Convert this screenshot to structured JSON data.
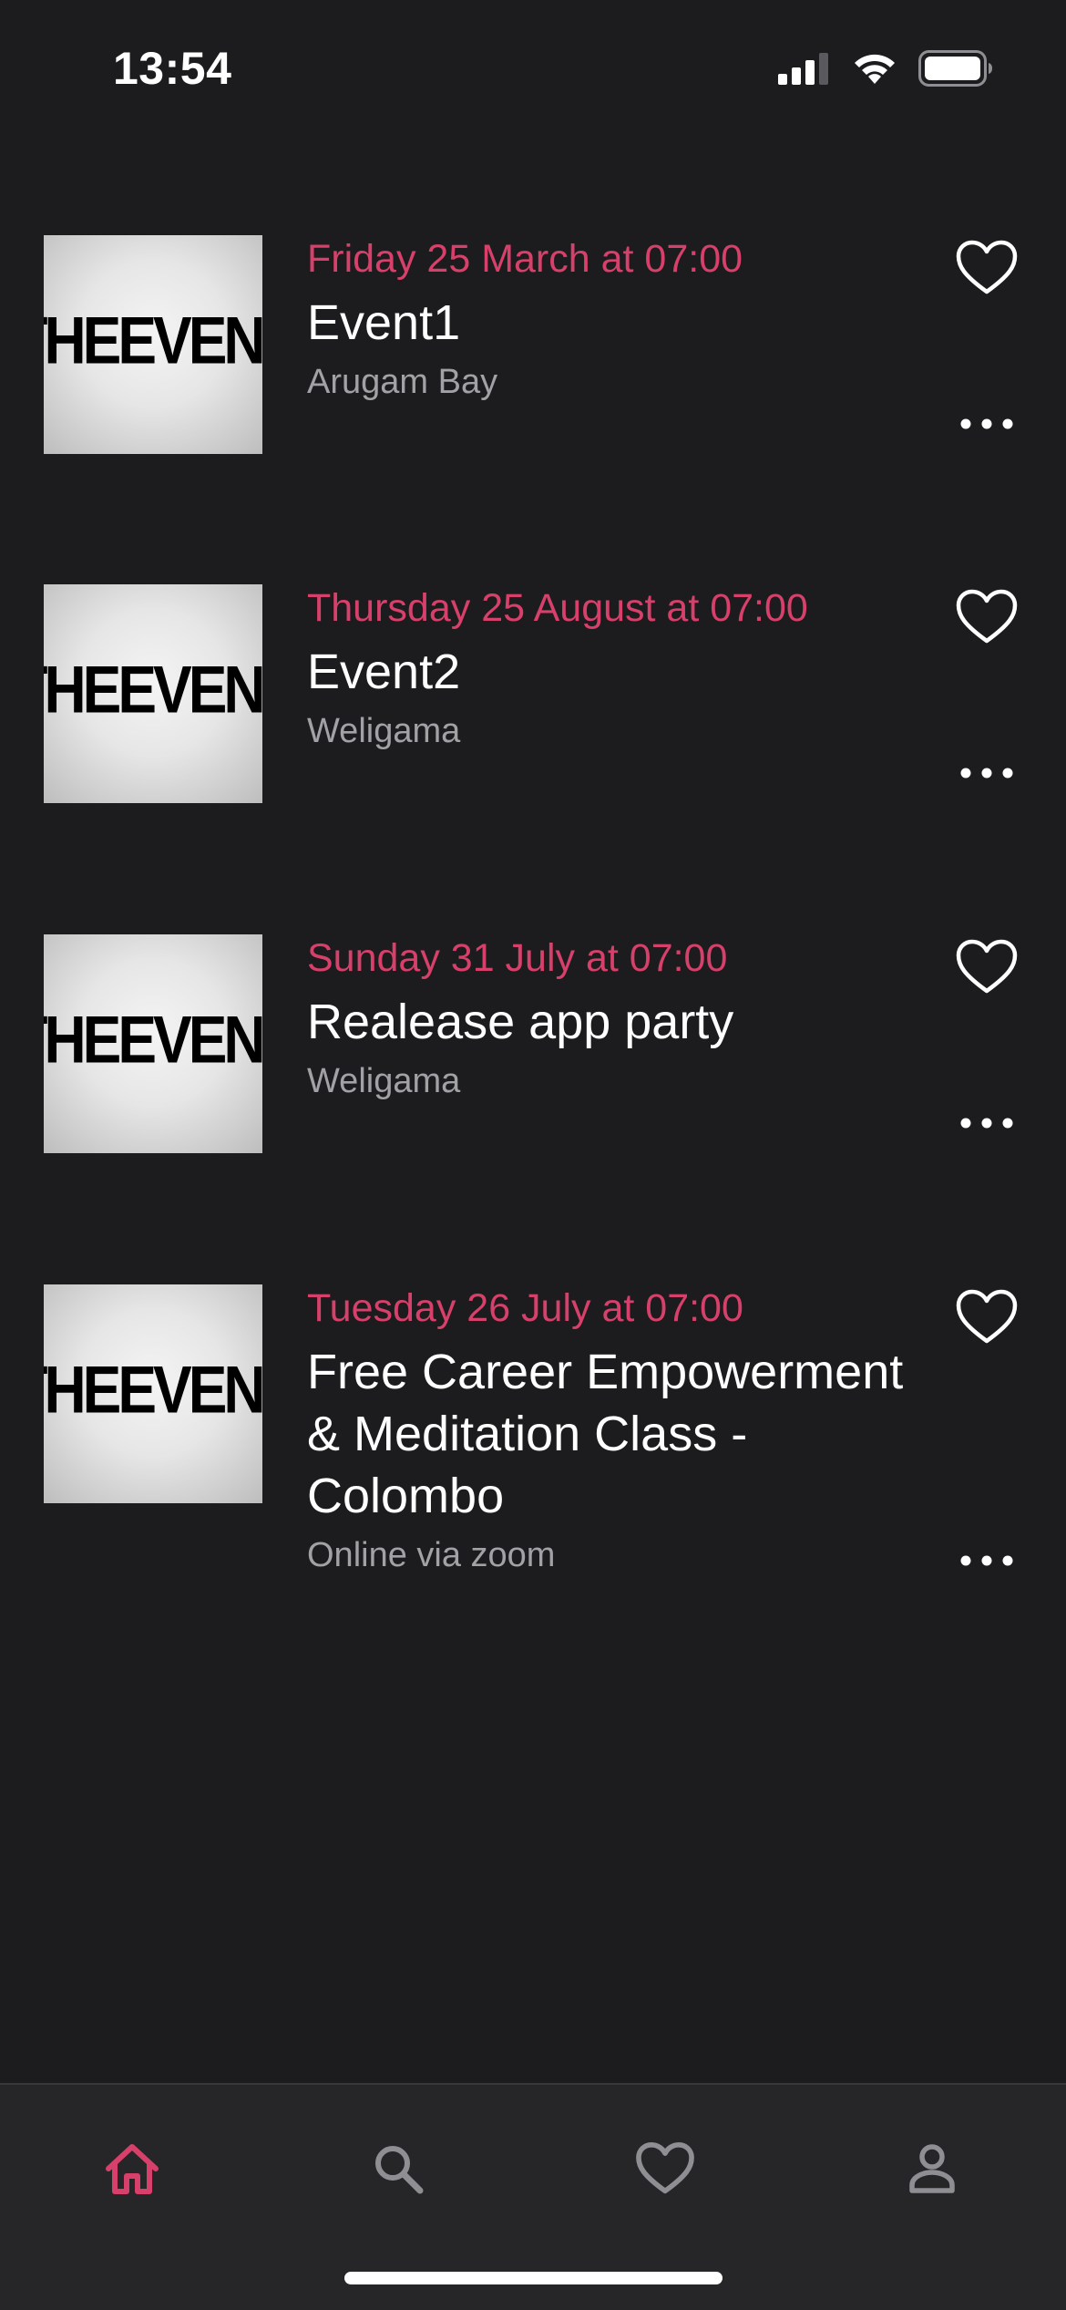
{
  "status_bar": {
    "time": "13:54",
    "icons": [
      "cellular-signal-icon",
      "wifi-icon",
      "battery-icon"
    ]
  },
  "events": [
    {
      "date": "Friday 25 March at 07:00",
      "title": "Event1",
      "location": "Arugam Bay",
      "thumbnail_text": "THEEVENT"
    },
    {
      "date": "Thursday 25 August at 07:00",
      "title": "Event2",
      "location": "Weligama",
      "thumbnail_text": "THEEVENT"
    },
    {
      "date": "Sunday 31 July at 07:00",
      "title": "Realease app party",
      "location": "Weligama",
      "thumbnail_text": "THEEVENT"
    },
    {
      "date": "Tuesday 26 July at 07:00",
      "title": "Free Career Empowerment & Meditation Class - Colombo",
      "location": "Online via zoom",
      "thumbnail_text": "THEEVENT"
    }
  ],
  "tab_bar": {
    "tabs": [
      {
        "name": "home",
        "icon": "home-icon",
        "active": true
      },
      {
        "name": "search",
        "icon": "search-icon",
        "active": false
      },
      {
        "name": "favorites",
        "icon": "heart-icon",
        "active": false
      },
      {
        "name": "profile",
        "icon": "person-icon",
        "active": false
      }
    ]
  },
  "colors": {
    "background": "#1c1c1e",
    "accent": "#d6406a",
    "secondary_text": "#a1a1a6",
    "tab_bar_background": "#262628",
    "inactive_icon": "#8e8e93"
  }
}
